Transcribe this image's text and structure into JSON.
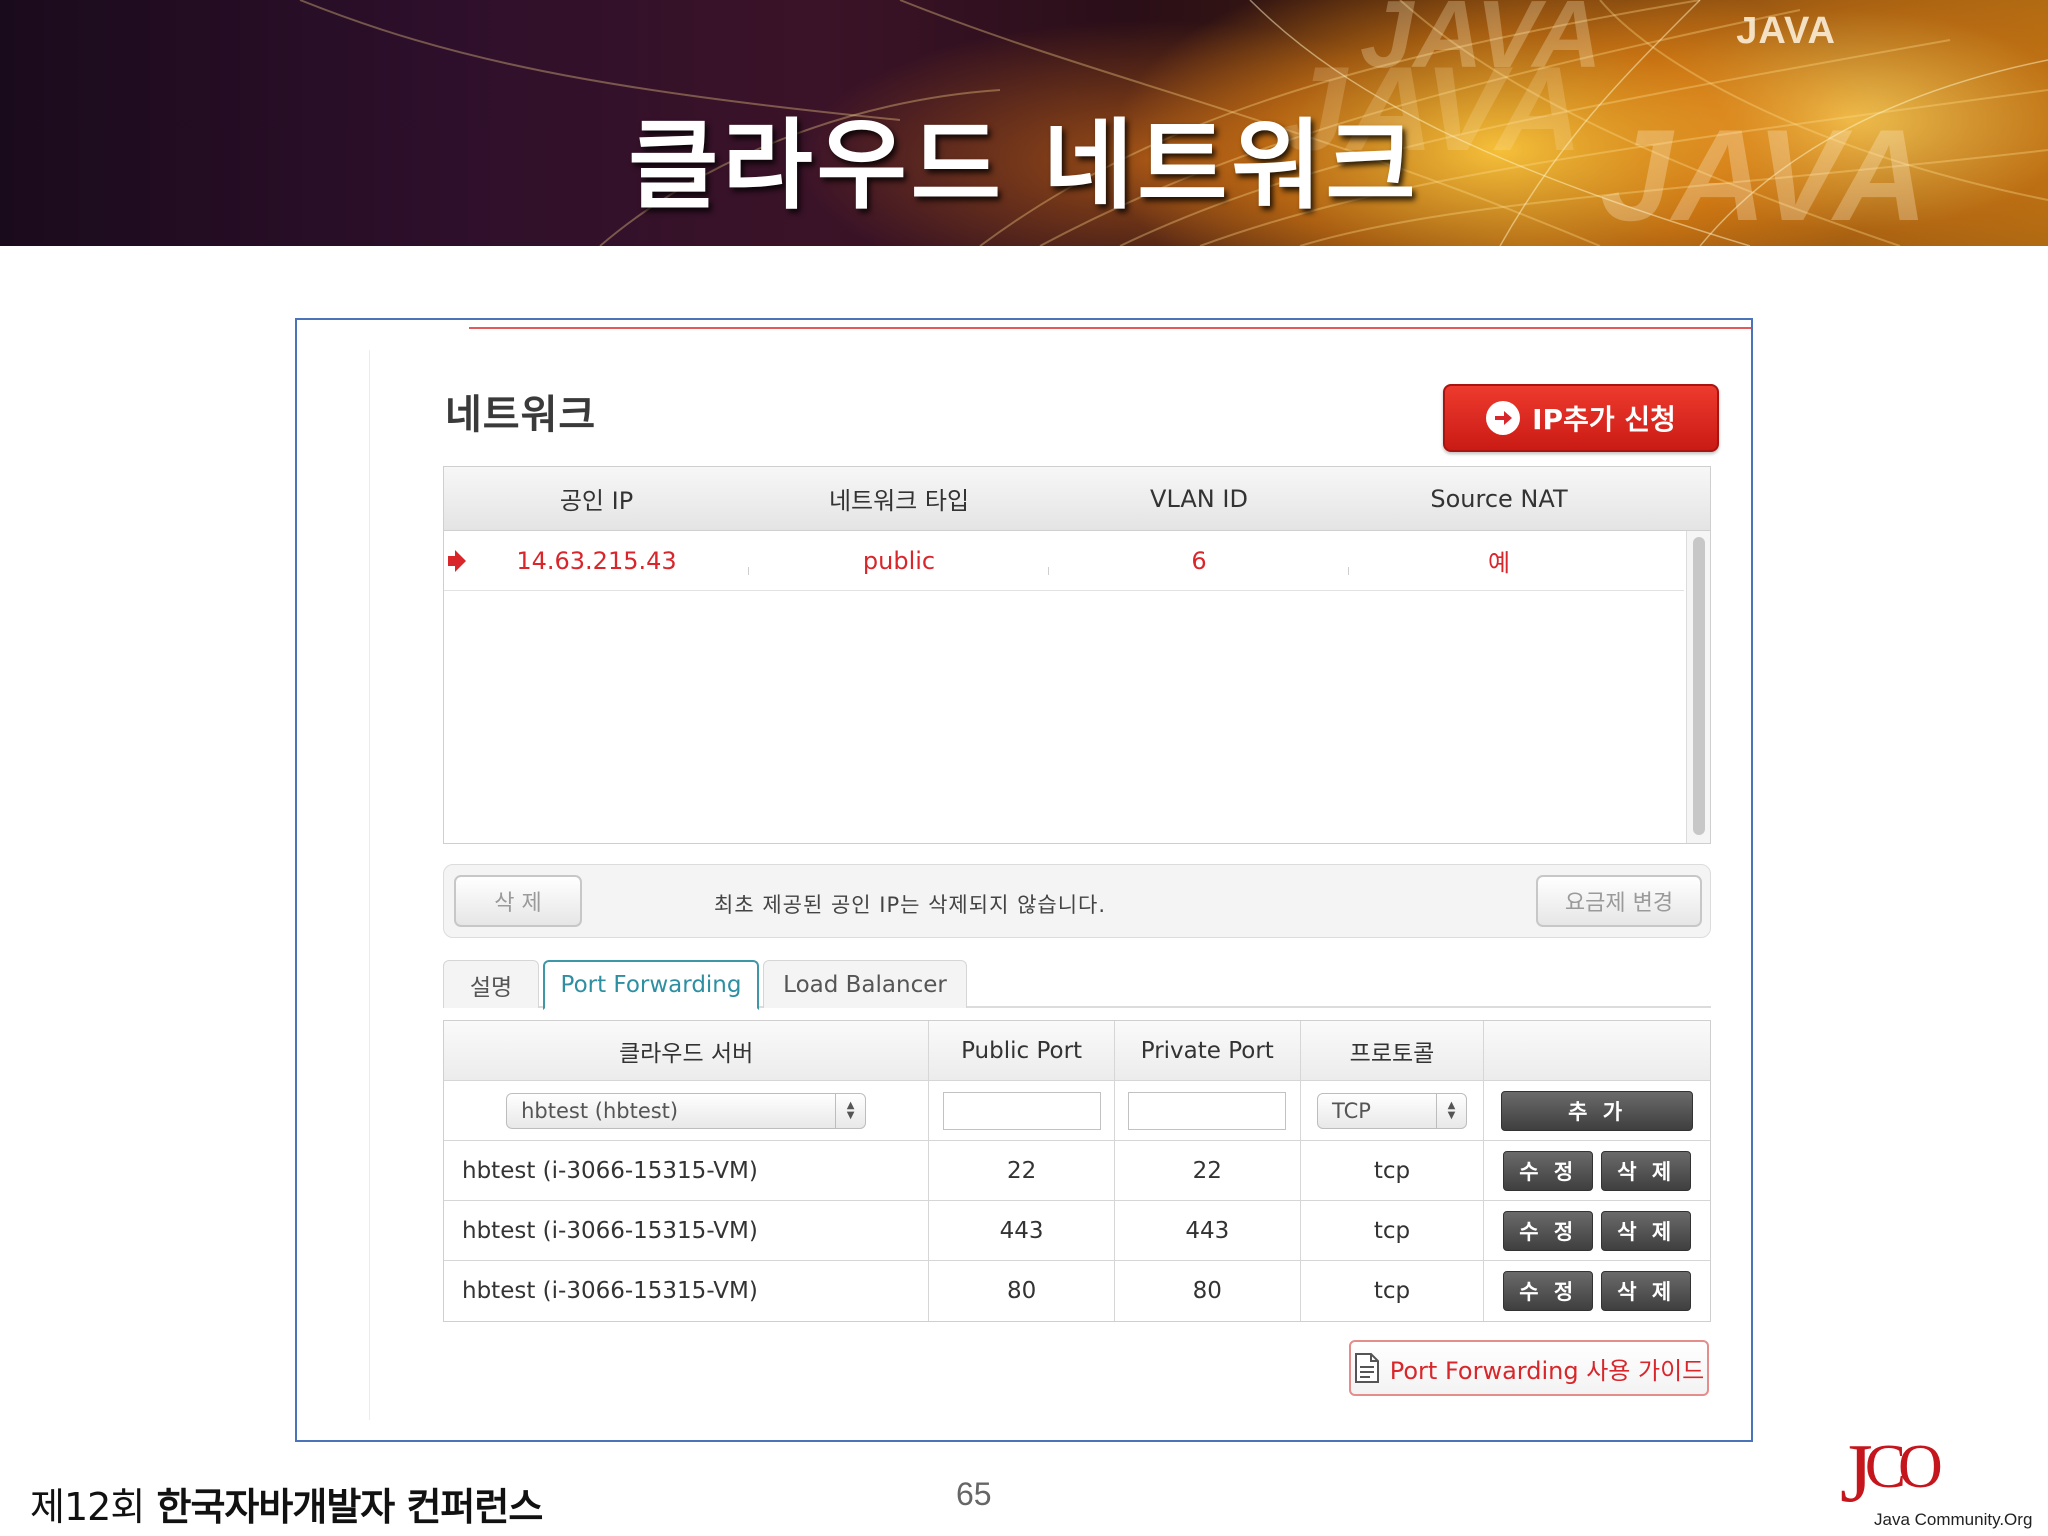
{
  "slide": {
    "title": "클라우드 네트워크",
    "banner_watermark": "JAVA",
    "banner_watermark_big": "JAVA",
    "banner_watermark_big2": "JAVA",
    "banner_watermark_big3": "JAVA",
    "page_number": "65",
    "footer_left": "제12회",
    "footer_event": "한국자바개발자 컨퍼런스",
    "logo_letters": "J",
    "logo_letters2": "CO",
    "logo_caption": "Java Community.Org"
  },
  "network": {
    "title": "네트워크",
    "add_ip_button": "IP추가 신청",
    "columns": [
      "공인 IP",
      "네트워크 타입",
      "VLAN ID",
      "Source NAT"
    ],
    "rows": [
      {
        "ip": "14.63.215.43",
        "type": "public",
        "vlan": "6",
        "source_nat": "예"
      }
    ],
    "delete_button": "삭 제",
    "notice": "최초 제공된 공인 IP는 삭제되지 않습니다.",
    "change_plan_button": "요금제 변경"
  },
  "tabs": [
    {
      "label": "설명",
      "active": false
    },
    {
      "label": "Port Forwarding",
      "active": true
    },
    {
      "label": "Load Balancer",
      "active": false
    }
  ],
  "port_forwarding": {
    "columns": [
      "클라우드 서버",
      "Public Port",
      "Private Port",
      "프로토콜",
      ""
    ],
    "new_row": {
      "server_select": "hbtest (hbtest)",
      "public_port": "",
      "private_port": "",
      "protocol_select": "TCP",
      "add_button": "추 가"
    },
    "rows": [
      {
        "server": "hbtest (i-3066-15315-VM)",
        "public_port": "22",
        "private_port": "22",
        "protocol": "tcp",
        "edit": "수 정",
        "delete": "삭 제"
      },
      {
        "server": "hbtest (i-3066-15315-VM)",
        "public_port": "443",
        "private_port": "443",
        "protocol": "tcp",
        "edit": "수 정",
        "delete": "삭 제"
      },
      {
        "server": "hbtest (i-3066-15315-VM)",
        "public_port": "80",
        "private_port": "80",
        "protocol": "tcp",
        "edit": "수 정",
        "delete": "삭 제"
      }
    ],
    "guide_button": "Port Forwarding 사용 가이드"
  },
  "colors": {
    "accent_red": "#d8262b",
    "tab_active": "#2e8fa2",
    "frame_border": "#4a73b9"
  },
  "icons": [
    "arrow-right-circle-icon",
    "row-pointer-icon",
    "select-spinner-icon",
    "document-icon"
  ]
}
